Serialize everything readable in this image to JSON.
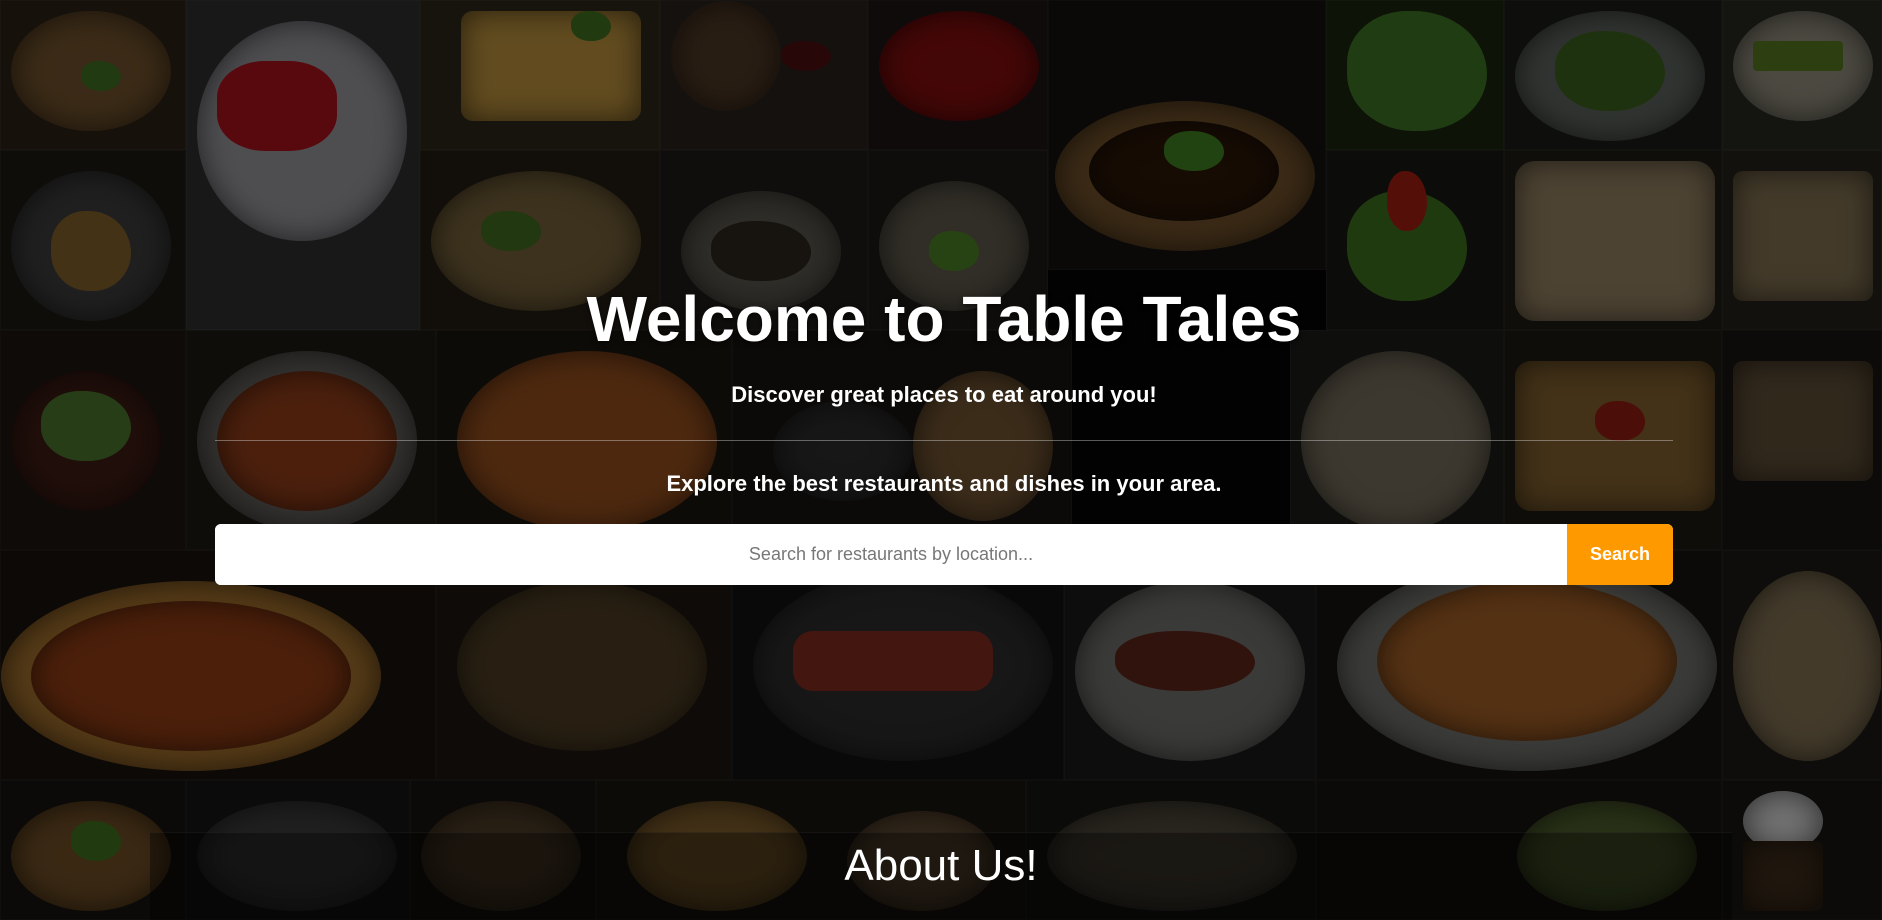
{
  "hero": {
    "title": "Welcome to Table Tales",
    "subtitle": "Discover great places to eat around you!",
    "tagline": "Explore the best restaurants and dishes in your area."
  },
  "search": {
    "placeholder": "Search for restaurants by location...",
    "value": "",
    "button_label": "Search"
  },
  "about": {
    "title": "About Us!"
  },
  "colors": {
    "accent": "#ff9900",
    "text": "#ffffff",
    "background": "#050505"
  }
}
